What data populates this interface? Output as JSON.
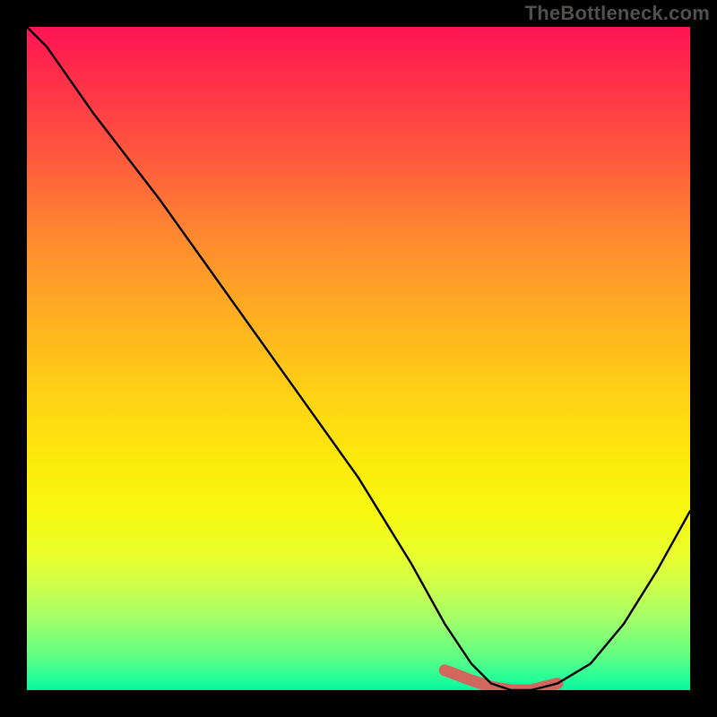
{
  "watermark": "TheBottleneck.com",
  "chart_data": {
    "type": "line",
    "title": "",
    "xlabel": "",
    "ylabel": "",
    "xlim": [
      0,
      100
    ],
    "ylim": [
      0,
      100
    ],
    "grid": false,
    "legend": false,
    "series": [
      {
        "name": "bottleneck-curve",
        "x": [
          0,
          3,
          10,
          20,
          30,
          40,
          50,
          58,
          63,
          67,
          70,
          73,
          76,
          80,
          85,
          90,
          95,
          100
        ],
        "values": [
          100,
          97,
          87,
          74,
          60,
          46,
          32,
          19,
          10,
          4,
          1,
          0,
          0,
          1,
          4,
          10,
          18,
          27
        ]
      }
    ],
    "highlight_region": {
      "name": "optimal-range",
      "x": [
        63,
        67,
        70,
        73,
        76,
        80
      ],
      "values": [
        3,
        1.5,
        0.5,
        0,
        0,
        1
      ]
    }
  }
}
